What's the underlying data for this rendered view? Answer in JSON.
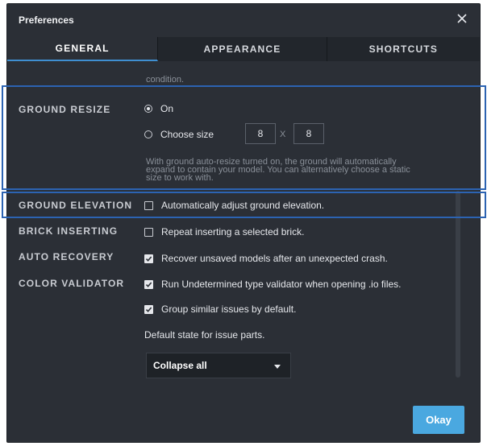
{
  "dialog": {
    "title": "Preferences",
    "close_icon": "close-icon"
  },
  "tabs": [
    {
      "label": "GENERAL",
      "active": true
    },
    {
      "label": "APPEARANCE",
      "active": false
    },
    {
      "label": "SHORTCUTS",
      "active": false
    }
  ],
  "faded_text": "condition.",
  "ground_resize": {
    "label": "GROUND RESIZE",
    "option_on": "On",
    "option_choose": "Choose size",
    "selected": "On",
    "width": "8",
    "separator": "X",
    "height": "8",
    "description_line1": "With ground auto-resize turned on, the ground will automatically",
    "description_line2": "expand to contain your model. You can alternatively choose a static",
    "description_line3": "size to work with."
  },
  "ground_elevation": {
    "label": "GROUND ELEVATION",
    "checkbox_label": "Automatically adjust ground elevation.",
    "checked": false
  },
  "brick_inserting": {
    "label": "BRICK INSERTING",
    "checkbox_label": "Repeat inserting a selected brick.",
    "checked": false
  },
  "auto_recovery": {
    "label": "AUTO RECOVERY",
    "checkbox_label": "Recover unsaved models after an unexpected crash.",
    "checked": true
  },
  "color_validator": {
    "label": "COLOR VALIDATOR",
    "checkbox1_label": "Run Undetermined type validator when opening .io files.",
    "checkbox1_checked": true,
    "checkbox2_label": "Group similar issues by default.",
    "checkbox2_checked": true,
    "default_state_label": "Default state for issue parts.",
    "dropdown_value": "Collapse all"
  },
  "footer": {
    "okay_label": "Okay"
  },
  "colors": {
    "accent": "#4aa8e0",
    "highlight": "#2c63b2",
    "background": "#2b2f36"
  }
}
